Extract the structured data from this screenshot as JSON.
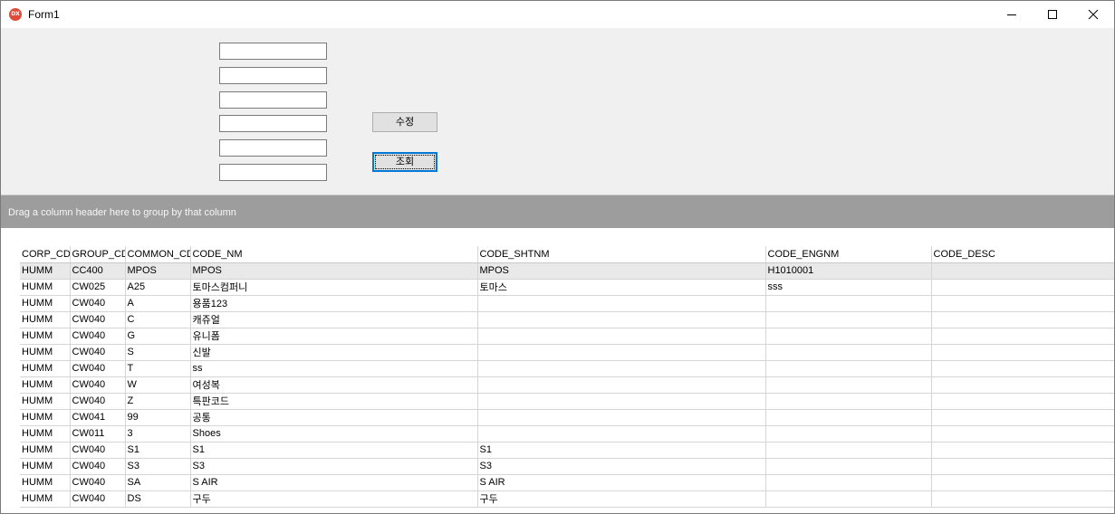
{
  "window": {
    "title": "Form1",
    "icon": "dx-icon"
  },
  "form": {
    "modify_label": "수정",
    "query_label": "조회"
  },
  "grid": {
    "group_panel_text": "Drag a column header here to group by that column",
    "columns": [
      "CORP_CD",
      "GROUP_CD",
      "COMMON_CD",
      "CODE_NM",
      "CODE_SHTNM",
      "CODE_ENGNM",
      "CODE_DESC"
    ],
    "rows": [
      [
        "HUMM",
        "CC400",
        "MPOS",
        "MPOS",
        "MPOS",
        "H1010001",
        ""
      ],
      [
        "HUMM",
        "CW025",
        "A25",
        "토마스컴퍼니",
        "토마스",
        "sss",
        ""
      ],
      [
        "HUMM",
        "CW040",
        "A",
        "용품123",
        "",
        "",
        ""
      ],
      [
        "HUMM",
        "CW040",
        "C",
        "캐쥬얼",
        "",
        "",
        ""
      ],
      [
        "HUMM",
        "CW040",
        "G",
        "유니폼",
        "",
        "",
        ""
      ],
      [
        "HUMM",
        "CW040",
        "S",
        "신발",
        "",
        "",
        ""
      ],
      [
        "HUMM",
        "CW040",
        "T",
        "ss",
        "",
        "",
        ""
      ],
      [
        "HUMM",
        "CW040",
        "W",
        "여성복",
        "",
        "",
        ""
      ],
      [
        "HUMM",
        "CW040",
        "Z",
        "특판코드",
        "",
        "",
        ""
      ],
      [
        "HUMM",
        "CW041",
        "99",
        "공통",
        "",
        "",
        ""
      ],
      [
        "HUMM",
        "CW011",
        "3",
        "Shoes",
        "",
        "",
        ""
      ],
      [
        "HUMM",
        "CW040",
        "S1",
        "S1",
        "S1",
        "",
        ""
      ],
      [
        "HUMM",
        "CW040",
        "S3",
        "S3",
        "S3",
        "",
        ""
      ],
      [
        "HUMM",
        "CW040",
        "SA",
        "S AIR",
        "S AIR",
        "",
        ""
      ],
      [
        "HUMM",
        "CW040",
        "DS",
        "구두",
        "구두",
        "",
        ""
      ]
    ]
  }
}
